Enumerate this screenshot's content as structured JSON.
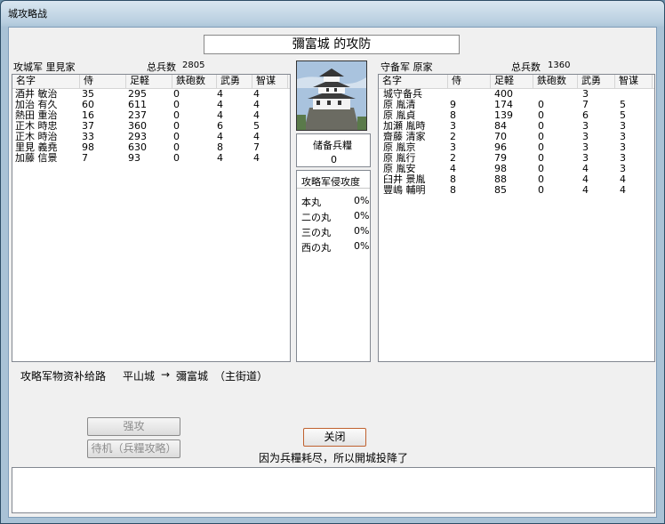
{
  "window": {
    "title": "城攻略战"
  },
  "header": {
    "title": "彌富城 的攻防"
  },
  "attack": {
    "label": "攻城军 里見家",
    "total_label": "总兵数",
    "total_value": "2805",
    "columns": [
      "名字",
      "侍",
      "足軽",
      "鉄砲数",
      "武勇",
      "智谋"
    ],
    "rows": [
      [
        "酒井 敏治",
        "35",
        "295",
        "0",
        "4",
        "4"
      ],
      [
        "加治 有久",
        "60",
        "611",
        "0",
        "4",
        "4"
      ],
      [
        "熱田 重治",
        "16",
        "237",
        "0",
        "4",
        "4"
      ],
      [
        "正木 時忠",
        "37",
        "360",
        "0",
        "6",
        "5"
      ],
      [
        "正木 時治",
        "33",
        "293",
        "0",
        "4",
        "4"
      ],
      [
        "里見 義堯",
        "98",
        "630",
        "0",
        "8",
        "7"
      ],
      [
        "加藤 信景",
        "7",
        "93",
        "0",
        "4",
        "4"
      ]
    ]
  },
  "defense": {
    "label": "守备军 原家",
    "total_label": "总兵数",
    "total_value": "1360",
    "columns": [
      "名字",
      "侍",
      "足軽",
      "鉄砲数",
      "武勇",
      "智谋"
    ],
    "rows": [
      [
        "城守备兵",
        "",
        "400",
        "",
        "3",
        ""
      ],
      [
        "原 胤清",
        "9",
        "174",
        "0",
        "7",
        "5"
      ],
      [
        "原 胤貞",
        "8",
        "139",
        "0",
        "6",
        "5"
      ],
      [
        "加瀬 胤時",
        "3",
        "84",
        "0",
        "3",
        "3"
      ],
      [
        "齋藤 清家",
        "2",
        "70",
        "0",
        "3",
        "3"
      ],
      [
        "原 胤京",
        "3",
        "96",
        "0",
        "3",
        "3"
      ],
      [
        "原 胤行",
        "2",
        "79",
        "0",
        "3",
        "3"
      ],
      [
        "原 胤安",
        "4",
        "98",
        "0",
        "4",
        "3"
      ],
      [
        "臼井 景胤",
        "8",
        "88",
        "0",
        "4",
        "4"
      ],
      [
        "豐嶋 輔明",
        "8",
        "85",
        "0",
        "4",
        "4"
      ]
    ]
  },
  "provisions": {
    "label": "储备兵糧",
    "value": "0"
  },
  "invasion": {
    "label": "攻略军侵攻度",
    "items": [
      {
        "name": "本丸",
        "pct": "0%"
      },
      {
        "name": "二の丸",
        "pct": "0%"
      },
      {
        "name": "三の丸",
        "pct": "0%"
      },
      {
        "name": "西の丸",
        "pct": "0%"
      }
    ]
  },
  "supply": {
    "label": "攻略军物资补给路",
    "from": "平山城",
    "arrow": "→",
    "to": "彌富城",
    "road": "（主街道）"
  },
  "buttons": {
    "assault": "强攻",
    "wait": "待机（兵糧攻略）",
    "close": "关闭"
  },
  "status": {
    "message": "因为兵糧耗尽，所以開城投降了"
  }
}
